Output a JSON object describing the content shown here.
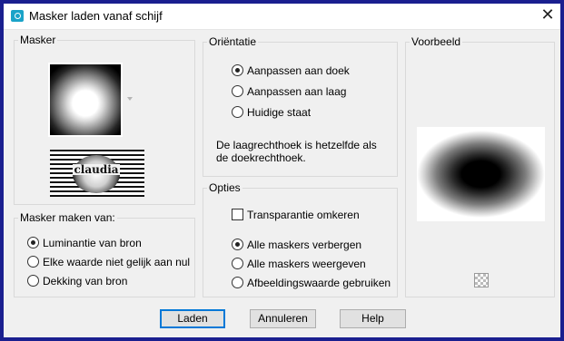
{
  "window": {
    "title": "Masker laden vanaf schijf"
  },
  "masker_group": {
    "legend": "Masker",
    "thumbnail_text": "claudia"
  },
  "source_group": {
    "legend": "Masker maken van:",
    "options": [
      {
        "label": "Luminantie van bron",
        "checked": true
      },
      {
        "label": "Elke waarde niet gelijk aan nul",
        "checked": false
      },
      {
        "label": "Dekking van bron",
        "checked": false
      }
    ]
  },
  "orientation_group": {
    "legend": "Oriëntatie",
    "options": [
      {
        "label": "Aanpassen aan doek",
        "checked": true
      },
      {
        "label": "Aanpassen aan laag",
        "checked": false
      },
      {
        "label": "Huidige staat",
        "checked": false
      }
    ],
    "description_line1": "De laagrechthoek is hetzelfde als",
    "description_line2": "de doekrechthoek."
  },
  "options_group": {
    "legend": "Opties",
    "invert_label": "Transparantie omkeren",
    "invert_checked": false,
    "options": [
      {
        "label": "Alle maskers verbergen",
        "checked": true
      },
      {
        "label": "Alle maskers weergeven",
        "checked": false
      },
      {
        "label": "Afbeeldingswaarde gebruiken",
        "checked": false
      }
    ]
  },
  "preview_group": {
    "legend": "Voorbeeld"
  },
  "buttons": {
    "load": "Laden",
    "cancel": "Annuleren",
    "help": "Help"
  }
}
